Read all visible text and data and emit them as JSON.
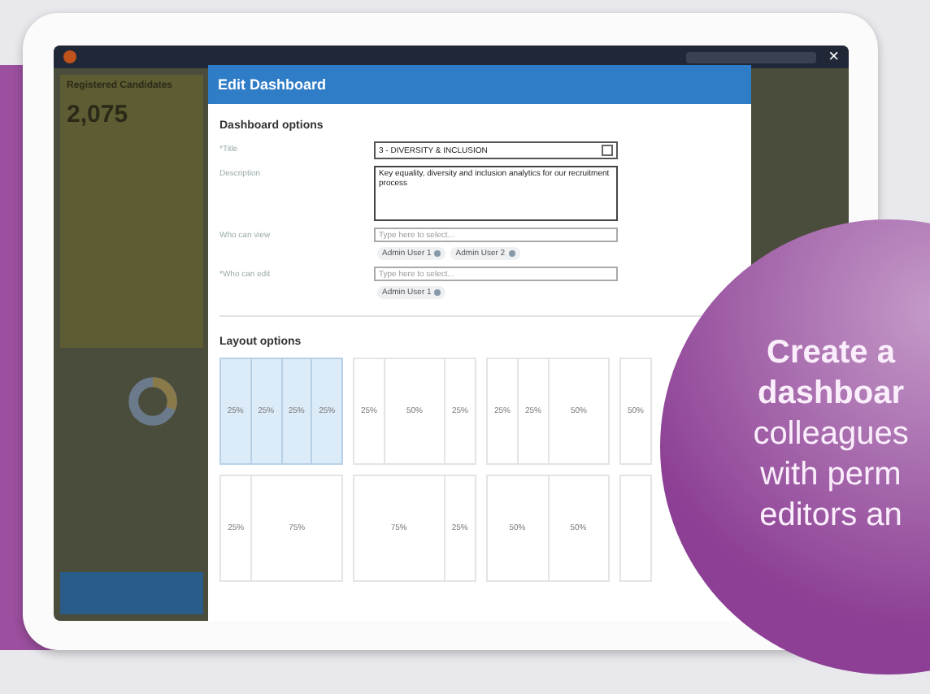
{
  "topbar": {
    "close": "×"
  },
  "sidebar": {
    "title": "Registered Candidates",
    "value": "2,075"
  },
  "modal": {
    "title": "Edit Dashboard",
    "options_heading": "Dashboard options",
    "title_field": {
      "label": "*Title",
      "value": "3 - DIVERSITY & INCLUSION"
    },
    "description": {
      "label": "Description",
      "value": "Key equality, diversity and inclusion analytics for our recruitment process"
    },
    "permissions": [
      {
        "label": "Who can view",
        "placeholder": "Type here to select...",
        "chips": [
          "Admin User 1",
          "Admin User 2"
        ]
      },
      {
        "label": "*Who can edit",
        "placeholder": "Type here to select...",
        "chips": [
          "Admin User 1"
        ]
      }
    ],
    "layout_heading": "Layout options",
    "layouts": [
      {
        "selected": true,
        "columns": [
          "25%",
          "25%",
          "25%",
          "25%"
        ]
      },
      {
        "selected": false,
        "columns": [
          "25%",
          "50%",
          "25%"
        ]
      },
      {
        "selected": false,
        "columns": [
          "25%",
          "25%",
          "50%"
        ]
      },
      {
        "selected": false,
        "columns": [
          "50%"
        ]
      },
      {
        "selected": false,
        "columns": [
          "25%",
          "75%"
        ]
      },
      {
        "selected": false,
        "columns": [
          "75%",
          "25%"
        ]
      },
      {
        "selected": false,
        "columns": [
          "50%",
          "50%"
        ]
      },
      {
        "selected": false
      }
    ]
  },
  "promo": {
    "lines": [
      {
        "text": "Create a",
        "bold": true
      },
      {
        "text": "dashboar",
        "bold": true
      },
      {
        "text": "colleagues",
        "bold": false
      },
      {
        "text": "with perm",
        "bold": false
      },
      {
        "text": "editors an",
        "bold": false
      }
    ]
  }
}
